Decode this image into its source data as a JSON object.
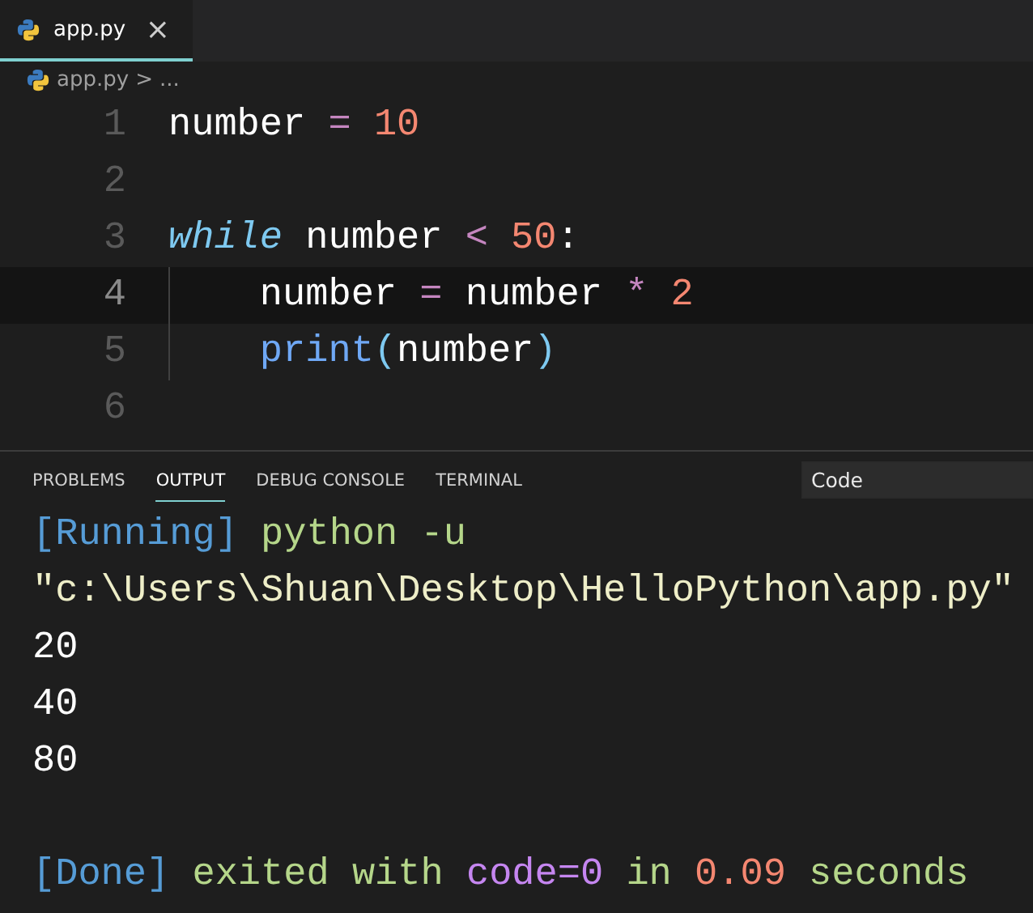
{
  "editor_tabs": [
    {
      "label": "app.py",
      "close": "×",
      "selected": true
    }
  ],
  "breadcrumb": {
    "file": "app.py",
    "separator": ">",
    "more": "..."
  },
  "code_lines": [
    {
      "number": "1",
      "current": false,
      "tokens": [
        {
          "kind": "var",
          "text": "number"
        },
        {
          "kind": "op",
          "text": " = "
        },
        {
          "kind": "num",
          "text": "10"
        }
      ]
    },
    {
      "number": "2",
      "current": false
    },
    {
      "number": "3",
      "current": false,
      "tokens": [
        {
          "kind": "kw",
          "text": "while"
        },
        {
          "kind": "var",
          "text": " number "
        },
        {
          "kind": "op",
          "text": "<"
        },
        {
          "kind": "num",
          "text": " 50"
        },
        {
          "kind": "var",
          "text": ":"
        }
      ]
    },
    {
      "number": "4",
      "current": true,
      "tokens": [
        {
          "kind": "var",
          "text": "    number "
        },
        {
          "kind": "op",
          "text": "="
        },
        {
          "kind": "var",
          "text": " number "
        },
        {
          "kind": "op",
          "text": "*"
        },
        {
          "kind": "num",
          "text": " 2"
        }
      ]
    },
    {
      "number": "5",
      "current": false,
      "tokens": [
        {
          "kind": "fn",
          "text": "    print"
        },
        {
          "kind": "paren",
          "text": "("
        },
        {
          "kind": "var",
          "text": "number"
        },
        {
          "kind": "paren",
          "text": ")"
        }
      ]
    },
    {
      "number": "6",
      "current": false
    }
  ],
  "panel_tabs": [
    {
      "label": "PROBLEMS",
      "selected": false
    },
    {
      "label": "OUTPUT",
      "selected": true
    },
    {
      "label": "DEBUG CONSOLE",
      "selected": false
    },
    {
      "label": "TERMINAL",
      "selected": false
    }
  ],
  "output_channel": "Code",
  "output_lines": [
    {
      "tokens": [
        {
          "kind": "tag",
          "text": "[Running]"
        },
        {
          "kind": "cmd",
          "text": " python -u"
        }
      ]
    },
    {
      "tokens": [
        {
          "kind": "path",
          "text": "\"c:\\Users\\Shuan\\Desktop\\HelloPython\\app.py\""
        }
      ]
    },
    {
      "tokens": [
        {
          "kind": "plain",
          "text": "20"
        }
      ]
    },
    {
      "tokens": [
        {
          "kind": "plain",
          "text": "40"
        }
      ]
    },
    {
      "tokens": [
        {
          "kind": "plain",
          "text": "80"
        }
      ]
    },
    {
      "kind": "blank"
    },
    {
      "tokens": [
        {
          "kind": "tag",
          "text": "[Done]"
        },
        {
          "kind": "cmd",
          "text": " exited with "
        },
        {
          "kind": "code",
          "text": "code=0"
        },
        {
          "kind": "cmd",
          "text": " in "
        },
        {
          "kind": "time",
          "text": "0.09"
        },
        {
          "kind": "cmd",
          "text": " seconds"
        }
      ]
    }
  ]
}
